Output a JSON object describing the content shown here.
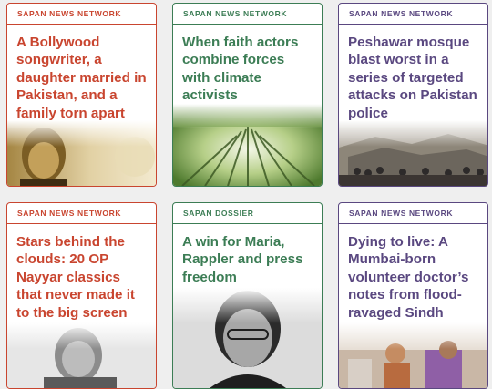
{
  "cards": [
    {
      "tag": "SAPAN NEWS NETWORK",
      "title": "A Bollywood songwriter, a daughter married in Pakistan, and a family torn apart",
      "accent": "#c9452f",
      "image": "sepia-portrait"
    },
    {
      "tag": "SAPAN NEWS NETWORK",
      "title": "When faith actors combine forces with climate activists",
      "accent": "#3c7d55",
      "image": "forest-canopy"
    },
    {
      "tag": "SAPAN NEWS NETWORK",
      "title": "Peshawar mosque blast worst in a series of targeted attacks on Pakistan police",
      "accent": "#5a4880",
      "image": "rubble-crowd"
    },
    {
      "tag": "SAPAN NEWS NETWORK",
      "title": "Stars behind the clouds: 20 OP Nayyar classics that never made it to the big screen",
      "accent": "#c9452f",
      "image": "bw-portrait"
    },
    {
      "tag": "SAPAN DOSSIER",
      "title": "A win for Maria, Rappler and press freedom",
      "accent": "#3c7d55",
      "image": "woman-portrait"
    },
    {
      "tag": "SAPAN NEWS NETWORK",
      "title": "Dying to live: A Mumbai-born volunteer doctor’s notes from flood-ravaged Sindh",
      "accent": "#5a4880",
      "image": "child-medical"
    }
  ]
}
